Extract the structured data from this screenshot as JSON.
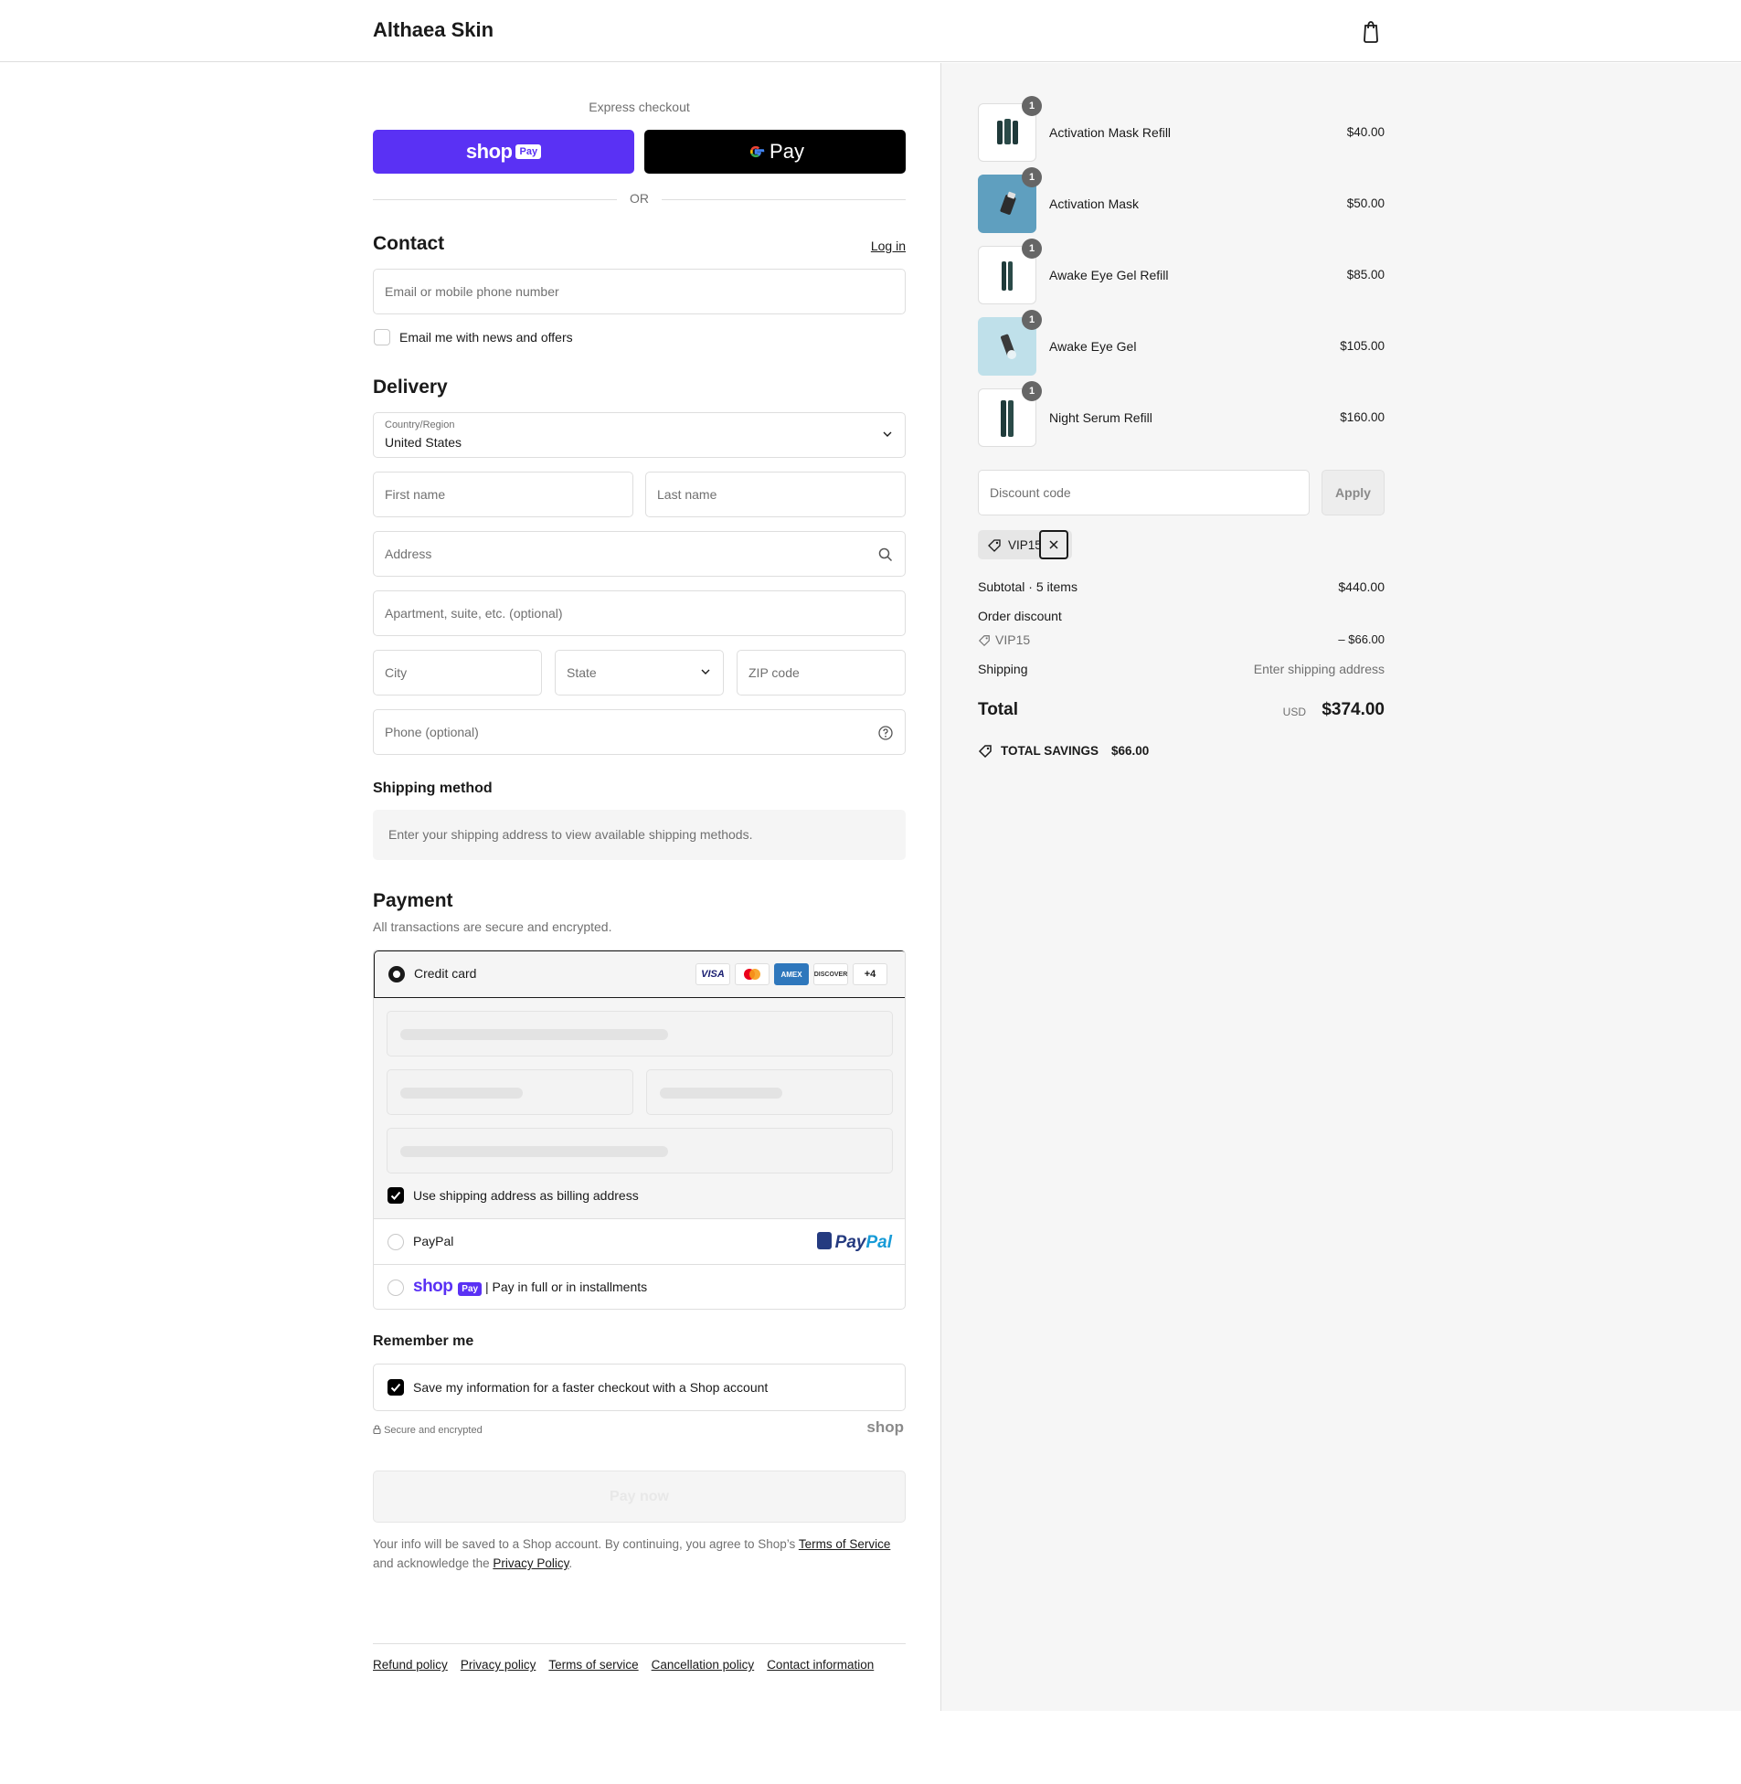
{
  "header": {
    "brand": "Althaea Skin",
    "cart_icon": "shopping-bag-icon"
  },
  "express": {
    "label": "Express checkout",
    "shop_pay_word": "shop",
    "shop_pay_pill": "Pay",
    "gpay_label": "Pay",
    "or_text": "OR"
  },
  "contact": {
    "title": "Contact",
    "login_link": "Log in",
    "email_placeholder": "Email or mobile phone number",
    "news_label": "Email me with news and offers",
    "news_checked": false
  },
  "delivery": {
    "title": "Delivery",
    "country_label": "Country/Region",
    "country_value": "United States",
    "first_name": "First name",
    "last_name": "Last name",
    "address": "Address",
    "apartment": "Apartment, suite, etc. (optional)",
    "city": "City",
    "state": "State",
    "zip": "ZIP code",
    "phone": "Phone (optional)"
  },
  "shipping_method": {
    "title": "Shipping method",
    "note": "Enter your shipping address to view available shipping methods."
  },
  "payment": {
    "title": "Payment",
    "subtitle": "All transactions are secure and encrypted.",
    "credit_card_label": "Credit card",
    "card_badges": [
      "VISA",
      "MC",
      "AMEX",
      "DISCOVER",
      "+4"
    ],
    "billing_label": "Use shipping address as billing address",
    "paypal_label": "PayPal",
    "paypal_logo_a": "Pay",
    "paypal_logo_b": "Pal",
    "shop_pay_word": "shop",
    "shop_pay_pill": "Pay",
    "shop_pay_text": "| Pay in full or in installments"
  },
  "remember": {
    "title": "Remember me",
    "save_label": "Save my information for a faster checkout with a Shop account",
    "secure_note": "Secure and encrypted",
    "shop_logo": "shop"
  },
  "pay_now_label": "Pay now",
  "legal": {
    "part1": "Your info will be saved to a Shop account. By continuing, you agree to Shop’s ",
    "tos": "Terms of Service",
    "part2": " and acknowledge the ",
    "privacy": "Privacy Policy",
    "part3": "."
  },
  "footer_links": [
    "Refund policy",
    "Privacy policy",
    "Terms of service",
    "Cancellation policy",
    "Contact information"
  ],
  "summary": {
    "items": [
      {
        "name": "Activation Mask Refill",
        "price": "$40.00",
        "qty": "1"
      },
      {
        "name": "Activation Mask",
        "price": "$50.00",
        "qty": "1"
      },
      {
        "name": "Awake Eye Gel Refill",
        "price": "$85.00",
        "qty": "1"
      },
      {
        "name": "Awake Eye Gel",
        "price": "$105.00",
        "qty": "1"
      },
      {
        "name": "Night Serum Refill",
        "price": "$160.00",
        "qty": "1"
      }
    ],
    "discount_placeholder": "Discount code",
    "apply_label": "Apply",
    "applied_code": "VIP15",
    "subtotal_label": "Subtotal · 5 items",
    "subtotal_value": "$440.00",
    "order_discount_label": "Order discount",
    "discount_code": "VIP15",
    "discount_value": "– $66.00",
    "shipping_label": "Shipping",
    "shipping_value": "Enter shipping address",
    "total_label": "Total",
    "currency": "USD",
    "total_value": "$374.00",
    "savings_label": "TOTAL SAVINGS",
    "savings_value": "$66.00"
  },
  "colors": {
    "shop_pay": "#5a31f4",
    "text": "#1a1a1a",
    "muted": "#707070",
    "panel": "#f6f6f6"
  }
}
